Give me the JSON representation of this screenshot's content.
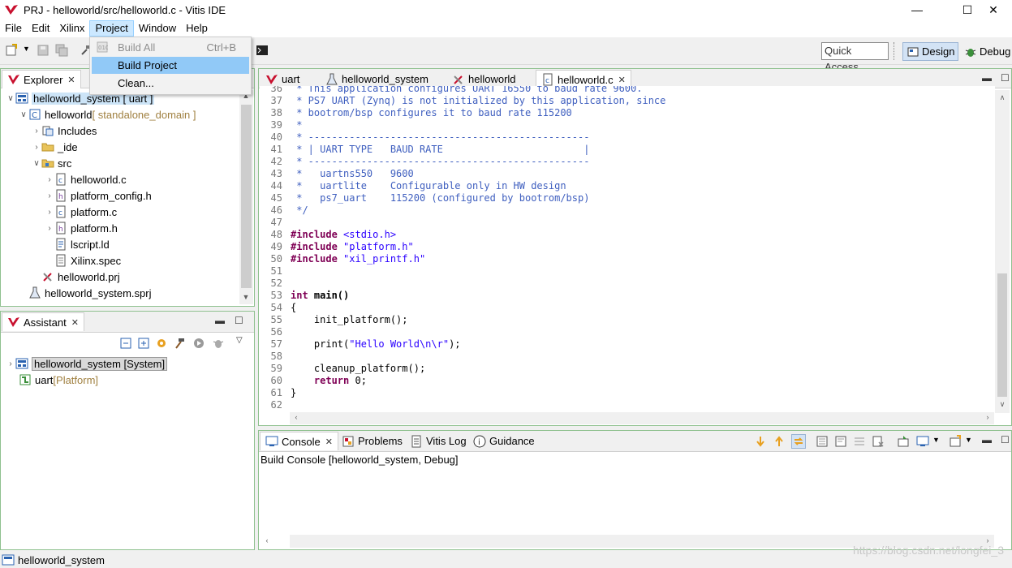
{
  "window": {
    "title": "PRJ - helloworld/src/helloworld.c - Vitis IDE"
  },
  "menu": [
    "File",
    "Edit",
    "Xilinx",
    "Project",
    "Window",
    "Help"
  ],
  "project_menu": {
    "items": [
      {
        "label": "Build All",
        "shortcut": "Ctrl+B",
        "state": "disabled"
      },
      {
        "label": "Build Project",
        "shortcut": "",
        "state": "selected"
      },
      {
        "label": "Clean...",
        "shortcut": "",
        "state": "normal"
      }
    ]
  },
  "toolbar": {
    "quick_access": "Quick Access",
    "design": "Design",
    "debug": "Debug"
  },
  "explorer": {
    "tab": "Explorer",
    "tree": [
      {
        "label": "helloworld_system",
        "suffix": " [ uart ]"
      },
      {
        "label": "helloworld",
        "suffix": " [ standalone_domain ]"
      },
      {
        "label": "Includes",
        "suffix": ""
      },
      {
        "label": "_ide",
        "suffix": ""
      },
      {
        "label": "src",
        "suffix": ""
      },
      {
        "label": "helloworld.c",
        "suffix": ""
      },
      {
        "label": "platform_config.h",
        "suffix": ""
      },
      {
        "label": "platform.c",
        "suffix": ""
      },
      {
        "label": "platform.h",
        "suffix": ""
      },
      {
        "label": "lscript.ld",
        "suffix": ""
      },
      {
        "label": "Xilinx.spec",
        "suffix": ""
      },
      {
        "label": "helloworld.prj",
        "suffix": ""
      },
      {
        "label": "helloworld_system.sprj",
        "suffix": ""
      }
    ]
  },
  "assistant": {
    "tab": "Assistant",
    "tree": [
      {
        "label": "helloworld_system [System]",
        "suffix": ""
      },
      {
        "label": "uart ",
        "suffix": "[Platform]"
      }
    ]
  },
  "editor": {
    "tabs": [
      "uart",
      "helloworld_system",
      "helloworld",
      "helloworld.c"
    ],
    "lines": [
      {
        "n": "36",
        "t": " * This application configures UART 16550 to baud rate 9600."
      },
      {
        "n": "37",
        "t": " * PS7 UART (Zynq) is not initialized by this application, since"
      },
      {
        "n": "38",
        "t": " * bootrom/bsp configures it to baud rate 115200"
      },
      {
        "n": "39",
        "t": " *"
      },
      {
        "n": "40",
        "t": " * ------------------------------------------------"
      },
      {
        "n": "41",
        "t": " * | UART TYPE   BAUD RATE                        |"
      },
      {
        "n": "42",
        "t": " * ------------------------------------------------"
      },
      {
        "n": "43",
        "t": " *   uartns550   9600"
      },
      {
        "n": "44",
        "t": " *   uartlite    Configurable only in HW design"
      },
      {
        "n": "45",
        "t": " *   ps7_uart    115200 (configured by bootrom/bsp)"
      },
      {
        "n": "46",
        "t": " */"
      },
      {
        "n": "47",
        "t": ""
      },
      {
        "n": "48",
        "t": "#include <stdio.h>"
      },
      {
        "n": "49",
        "t": "#include \"platform.h\""
      },
      {
        "n": "50",
        "t": "#include \"xil_printf.h\""
      },
      {
        "n": "51",
        "t": ""
      },
      {
        "n": "52",
        "t": ""
      },
      {
        "n": "53",
        "t": "int main()"
      },
      {
        "n": "54",
        "t": "{"
      },
      {
        "n": "55",
        "t": "    init_platform();"
      },
      {
        "n": "56",
        "t": ""
      },
      {
        "n": "57",
        "t": "    print(\"Hello World\\n\\r\");"
      },
      {
        "n": "58",
        "t": ""
      },
      {
        "n": "59",
        "t": "    cleanup_platform();"
      },
      {
        "n": "60",
        "t": "    return 0;"
      },
      {
        "n": "61",
        "t": "}"
      },
      {
        "n": "62",
        "t": ""
      }
    ]
  },
  "console": {
    "tabs": [
      "Console",
      "Problems",
      "Vitis Log",
      "Guidance"
    ],
    "label": "Build Console [helloworld_system, Debug]"
  },
  "status": {
    "text": "helloworld_system"
  },
  "watermark": "https://blog.csdn.net/longfei_3"
}
